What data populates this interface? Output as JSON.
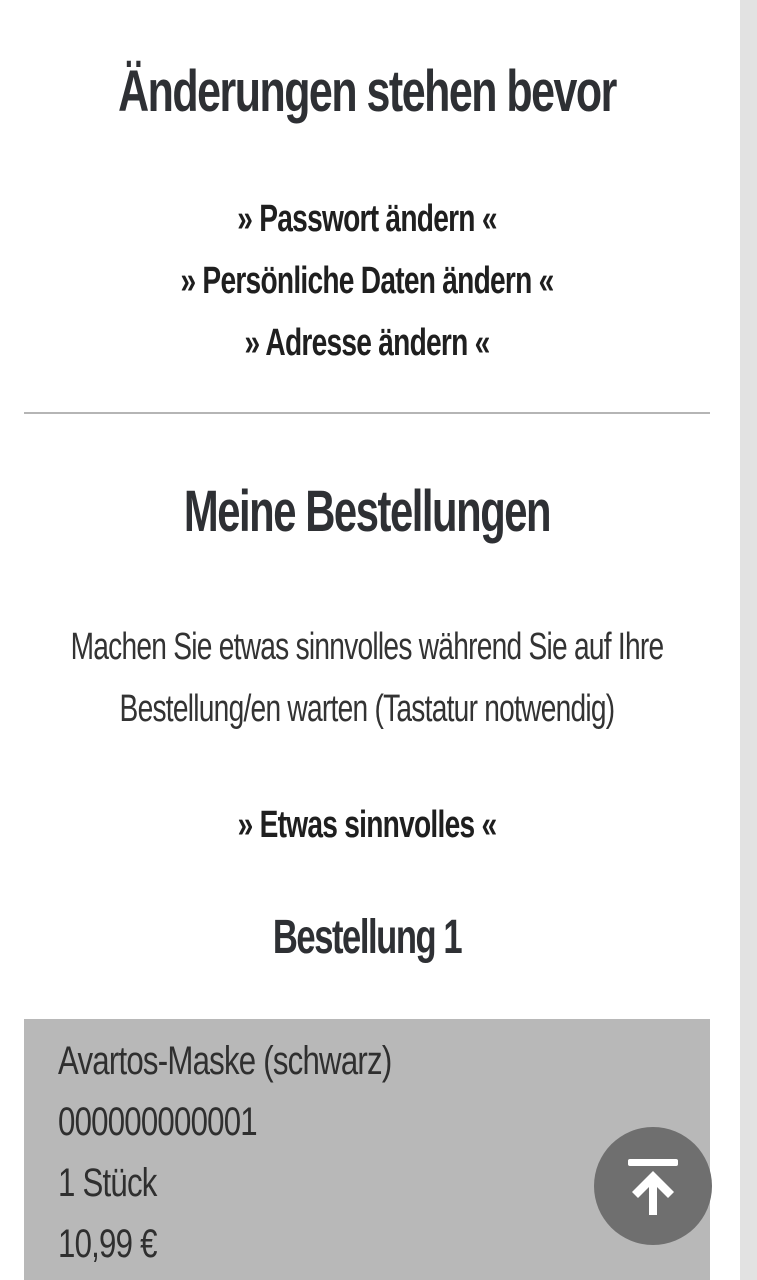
{
  "account": {
    "changes_heading": "Änderungen stehen bevor",
    "links": [
      {
        "label": "» Passwort ändern «"
      },
      {
        "label": "» Persönliche Daten ändern «"
      },
      {
        "label": "» Adresse ändern «"
      }
    ]
  },
  "orders": {
    "heading": "Meine Bestellungen",
    "intro_text": "Machen Sie etwas sinnvolles während Sie auf Ihre Bestellung/en warten (Tastatur notwendig)",
    "intro_link": "» Etwas sinnvolles «",
    "items": [
      {
        "title": "Bestellung 1",
        "product": "Avartos-Maske (schwarz)",
        "number": "000000000001",
        "quantity": "1 Stück",
        "price": "10,99 €"
      }
    ]
  },
  "ui": {
    "back_to_top_icon": "arrow-up-to-line-icon",
    "order_box_color": "#b8b8b8",
    "back_to_top_color": "#6f6f6f"
  }
}
